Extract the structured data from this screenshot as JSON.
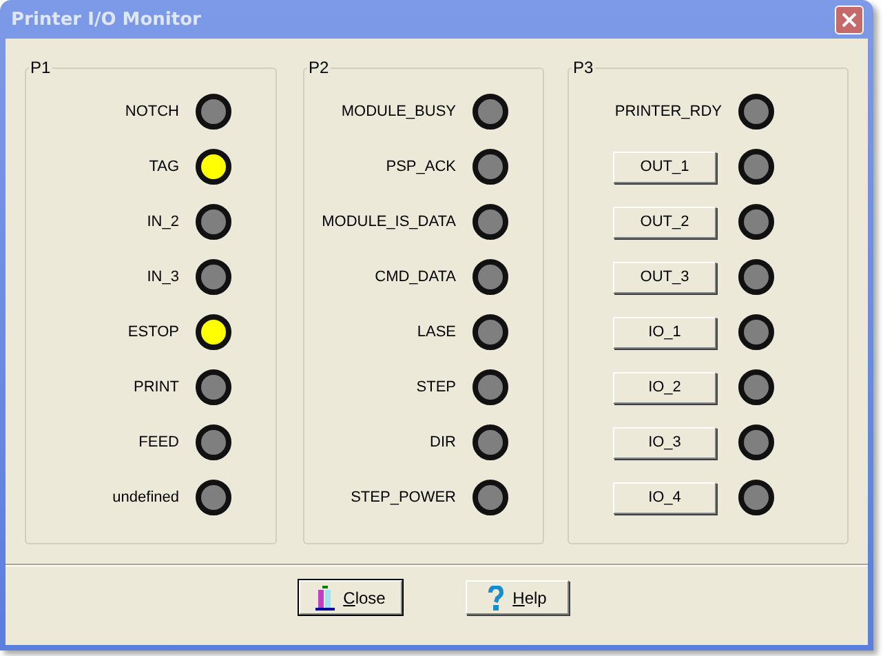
{
  "window": {
    "title": "Printer I/O Monitor"
  },
  "groups": [
    {
      "title": "P1",
      "items": [
        {
          "kind": "label",
          "label": "NOTCH",
          "on": false
        },
        {
          "kind": "label",
          "label": "TAG",
          "on": true
        },
        {
          "kind": "label",
          "label": "IN_2",
          "on": false
        },
        {
          "kind": "label",
          "label": "IN_3",
          "on": false
        },
        {
          "kind": "label",
          "label": "ESTOP",
          "on": true
        },
        {
          "kind": "label",
          "label": "PRINT",
          "on": false
        },
        {
          "kind": "label",
          "label": "FEED",
          "on": false
        },
        {
          "kind": "label",
          "label": "undefined",
          "on": false
        }
      ]
    },
    {
      "title": "P2",
      "items": [
        {
          "kind": "label",
          "label": "MODULE_BUSY",
          "on": false
        },
        {
          "kind": "label",
          "label": "PSP_ACK",
          "on": false
        },
        {
          "kind": "label",
          "label": "MODULE_IS_DATA",
          "on": false
        },
        {
          "kind": "label",
          "label": "CMD_DATA",
          "on": false
        },
        {
          "kind": "label",
          "label": "LASE",
          "on": false
        },
        {
          "kind": "label",
          "label": "STEP",
          "on": false
        },
        {
          "kind": "label",
          "label": "DIR",
          "on": false
        },
        {
          "kind": "label",
          "label": "STEP_POWER",
          "on": false
        }
      ]
    },
    {
      "title": "P3",
      "items": [
        {
          "kind": "label",
          "label": "PRINTER_RDY",
          "on": false
        },
        {
          "kind": "button",
          "label": "OUT_1",
          "on": false
        },
        {
          "kind": "button",
          "label": "OUT_2",
          "on": false
        },
        {
          "kind": "button",
          "label": "OUT_3",
          "on": false
        },
        {
          "kind": "button",
          "label": "IO_1",
          "on": false
        },
        {
          "kind": "button",
          "label": "IO_2",
          "on": false
        },
        {
          "kind": "button",
          "label": "IO_3",
          "on": false
        },
        {
          "kind": "button",
          "label": "IO_4",
          "on": false
        }
      ]
    }
  ],
  "buttons": [
    {
      "kind": "close",
      "label": "Close",
      "default": true
    },
    {
      "kind": "help",
      "label": "Help",
      "default": false
    }
  ]
}
